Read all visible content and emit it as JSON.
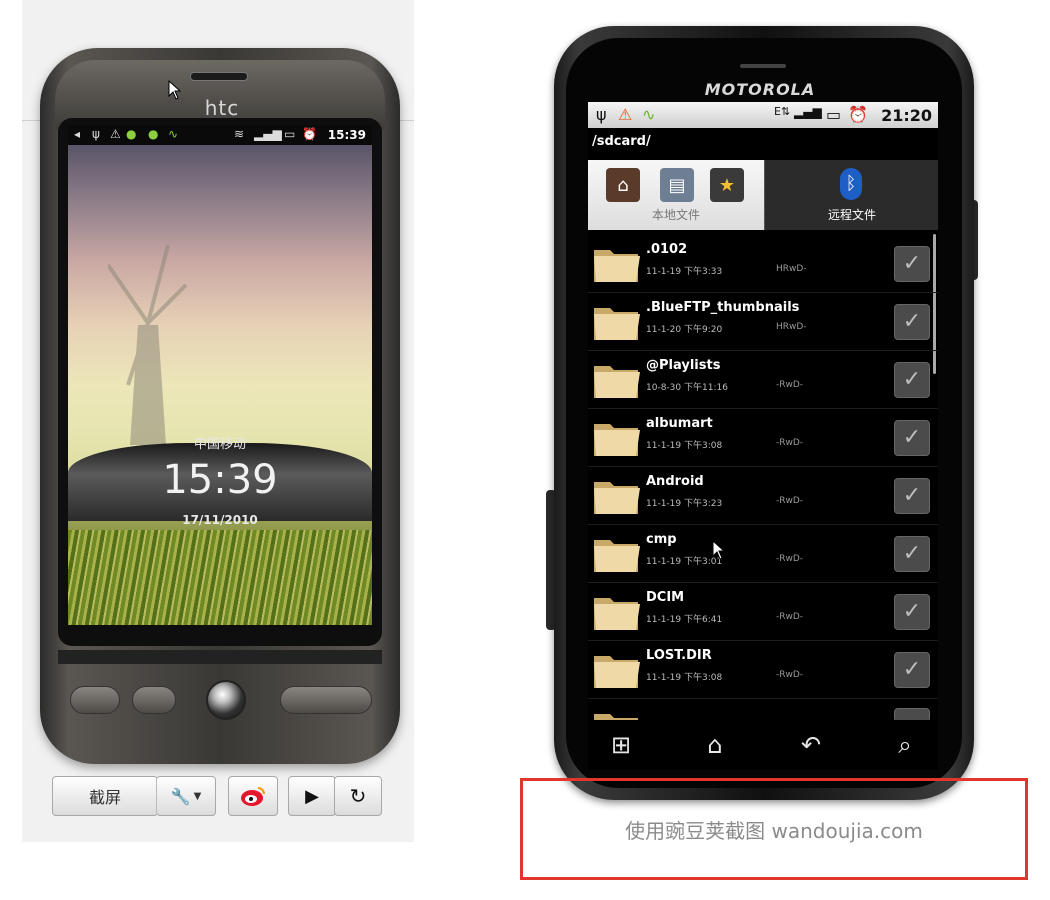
{
  "htc": {
    "brand": "htc",
    "status_time": "15:39",
    "carrier": "中国移动",
    "clock": "15:39",
    "date": "17/11/2010",
    "toolbar": {
      "screenshot_label": "截屏",
      "tools_icon": "wrench-icon",
      "weibo_icon": "weibo-icon",
      "play_icon": "play-icon",
      "refresh_icon": "refresh-icon"
    }
  },
  "motorola": {
    "brand": "MOTOROLA",
    "status_time": "21:20",
    "path": "/sdcard/",
    "tabs": [
      {
        "label": "本地文件",
        "active": true
      },
      {
        "label": "远程文件",
        "active": false
      }
    ],
    "files": [
      {
        "name": ".0102",
        "date": "11-1-19 下午3:33",
        "perm": "HRwD-"
      },
      {
        "name": ".BlueFTP_thumbnails",
        "date": "11-1-20 下午9:20",
        "perm": "HRwD-"
      },
      {
        "name": "@Playlists",
        "date": "10-8-30 下午11:16",
        "perm": "-RwD-"
      },
      {
        "name": "albumart",
        "date": "11-1-19 下午3:08",
        "perm": "-RwD-"
      },
      {
        "name": "Android",
        "date": "11-1-19 下午3:23",
        "perm": "-RwD-"
      },
      {
        "name": "cmp",
        "date": "11-1-19 下午3:01",
        "perm": "-RwD-"
      },
      {
        "name": "DCIM",
        "date": "11-1-19 下午6:41",
        "perm": "-RwD-"
      },
      {
        "name": "LOST.DIR",
        "date": "11-1-19 下午3:08",
        "perm": "-RwD-"
      }
    ],
    "nav": [
      "grid-icon",
      "home-icon",
      "back-icon",
      "search-icon"
    ]
  },
  "watermark": "使用豌豆荚截图  wandoujia.com",
  "colors": {
    "watermark_border": "#e0362b",
    "bluetooth": "#1e5fc7"
  }
}
